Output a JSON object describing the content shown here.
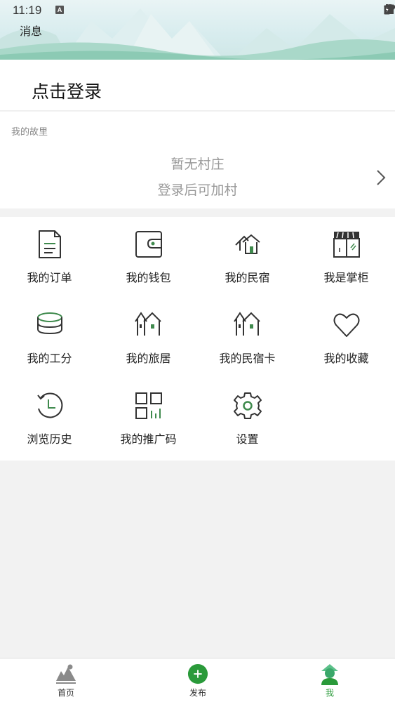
{
  "status_bar": {
    "time": "11:19",
    "notification_badge": "A"
  },
  "header": {
    "messages_label": "消息"
  },
  "login": {
    "label": "点击登录"
  },
  "hometown": {
    "title": "我的故里",
    "empty_text": "暂无村庄",
    "hint_text": "登录后可加村"
  },
  "menu": [
    {
      "label": "我的订单",
      "icon": "order-document-icon"
    },
    {
      "label": "我的钱包",
      "icon": "wallet-icon"
    },
    {
      "label": "我的民宿",
      "icon": "homestay-icon"
    },
    {
      "label": "我是掌柜",
      "icon": "storefront-icon"
    },
    {
      "label": "我的工分",
      "icon": "coin-stack-icon"
    },
    {
      "label": "我的旅居",
      "icon": "village-house-icon"
    },
    {
      "label": "我的民宿卡",
      "icon": "homestay-card-icon"
    },
    {
      "label": "我的收藏",
      "icon": "heart-icon"
    },
    {
      "label": "浏览历史",
      "icon": "history-clock-icon"
    },
    {
      "label": "我的推广码",
      "icon": "qr-code-icon"
    },
    {
      "label": "设置",
      "icon": "gear-icon"
    }
  ],
  "bottom_nav": [
    {
      "label": "首页",
      "icon": "mountain-home-icon"
    },
    {
      "label": "发布",
      "icon": "plus-circle-icon"
    },
    {
      "label": "我",
      "icon": "profile-icon"
    }
  ],
  "colors": {
    "accent": "#2a9a3a",
    "icon_green": "#3f8a4d",
    "icon_dark": "#333333"
  }
}
